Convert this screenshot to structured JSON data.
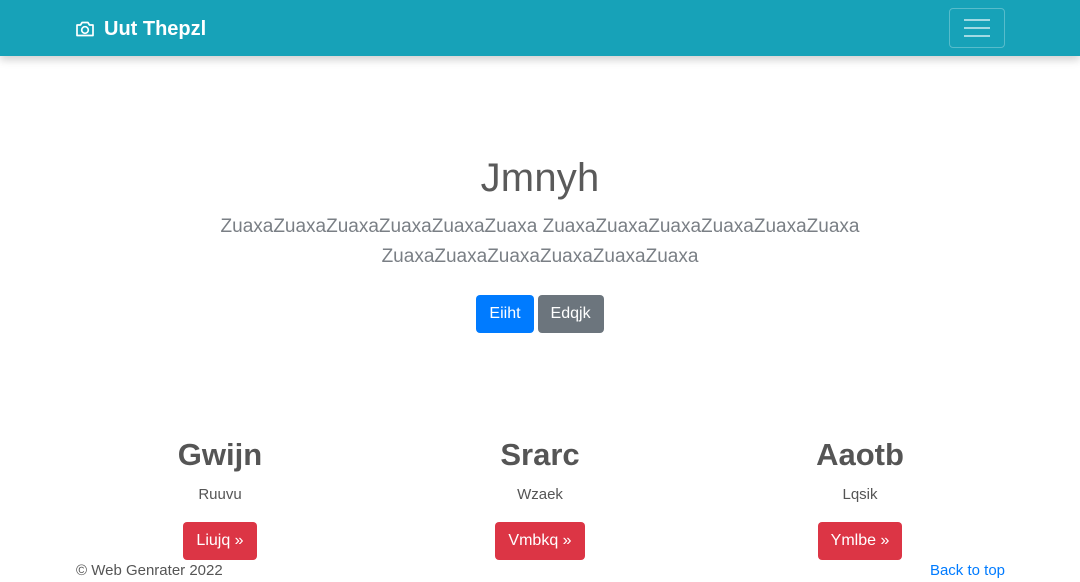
{
  "navbar": {
    "brand_icon": "camera-icon",
    "brand": "Uut Thepzl",
    "toggler_icon": "hamburger-menu-icon",
    "background": "#17a2b8"
  },
  "hero": {
    "title": "Jmnyh",
    "lead": "ZuaxaZuaxaZuaxaZuaxaZuaxaZuaxa ZuaxaZuaxaZuaxaZuaxaZuaxaZuaxa ZuaxaZuaxaZuaxaZuaxaZuaxaZuaxa",
    "primary_button": "Eiiht",
    "secondary_button": "Edqjk"
  },
  "features": [
    {
      "title": "Gwijn",
      "text": "Ruuvu",
      "button": "Liujq »"
    },
    {
      "title": "Srarc",
      "text": "Wzaek",
      "button": "Vmbkq »"
    },
    {
      "title": "Aaotb",
      "text": "Lqsik",
      "button": "Ymlbe »"
    }
  ],
  "footer": {
    "copyright": "© Web Genrater 2022",
    "back_to_top": "Back to top"
  },
  "colors": {
    "primary": "#007bff",
    "secondary": "#6c757d",
    "danger": "#dc3545"
  }
}
